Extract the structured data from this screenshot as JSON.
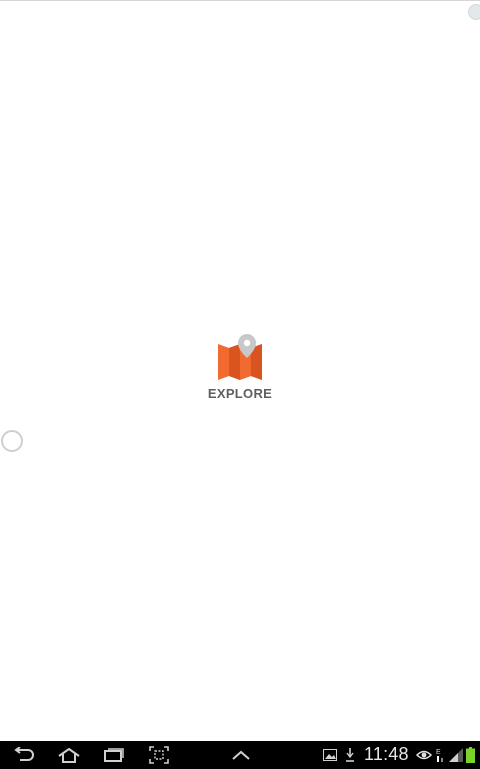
{
  "splash": {
    "label": "EXPLORE",
    "logo_icon": "folded-map-with-pin-icon",
    "colors": {
      "map": "#f26a30",
      "map_fold": "#d9541f",
      "pin": "#c8c8c8",
      "label": "#5e5e5e"
    }
  },
  "status_bar": {
    "time": "11:48",
    "icons": [
      "gallery-icon",
      "download-icon",
      "eye-icon",
      "network-icon",
      "signal-icon",
      "battery-icon"
    ]
  },
  "nav_bar": {
    "buttons": [
      "back-icon",
      "home-icon",
      "recent-apps-icon",
      "screenshot-icon",
      "up-chevron-icon"
    ]
  }
}
